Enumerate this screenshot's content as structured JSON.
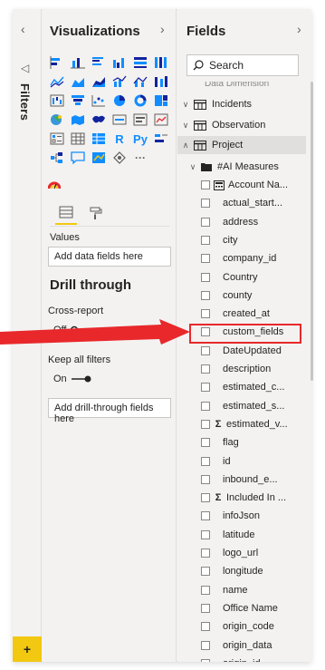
{
  "filters": {
    "label": "Filters",
    "collapse_icon": "chevron-left-icon",
    "add_button_label": "+"
  },
  "visualizations": {
    "title": "Visualizations",
    "expand_icon": "chevron-right-icon",
    "text_icons": [
      "R",
      "Py"
    ],
    "more_label": "···",
    "values_label": "Values",
    "values_well_placeholder": "Add data fields here",
    "drill_through_title": "Drill through",
    "cross_report_label": "Cross-report",
    "cross_report_state": "Off",
    "keep_all_filters_label": "Keep all filters",
    "keep_all_filters_state": "On",
    "drill_well_placeholder": "Add drill-through fields here"
  },
  "fields": {
    "title": "Fields",
    "expand_icon": "chevron-right-icon",
    "search_placeholder": "Search",
    "partial_top_item": "Data Dimension",
    "tables": [
      {
        "name": "Incidents",
        "expanded": false
      },
      {
        "name": "Observation",
        "expanded": false
      },
      {
        "name": "Project",
        "expanded": true
      }
    ],
    "measure_folder": "#AI Measures",
    "items": [
      {
        "label": "Account Na...",
        "kind": "calc"
      },
      {
        "label": "actual_start...",
        "kind": "field"
      },
      {
        "label": "address",
        "kind": "field"
      },
      {
        "label": "city",
        "kind": "field"
      },
      {
        "label": "company_id",
        "kind": "field"
      },
      {
        "label": "Country",
        "kind": "field"
      },
      {
        "label": "county",
        "kind": "field"
      },
      {
        "label": "created_at",
        "kind": "field"
      },
      {
        "label": "custom_fields",
        "kind": "field"
      },
      {
        "label": "DateUpdated",
        "kind": "field"
      },
      {
        "label": "description",
        "kind": "field"
      },
      {
        "label": "estimated_c...",
        "kind": "field"
      },
      {
        "label": "estimated_s...",
        "kind": "field"
      },
      {
        "label": "estimated_v...",
        "kind": "sum"
      },
      {
        "label": "flag",
        "kind": "field"
      },
      {
        "label": "id",
        "kind": "field"
      },
      {
        "label": "inbound_e...",
        "kind": "field"
      },
      {
        "label": "Included In ...",
        "kind": "sum"
      },
      {
        "label": "infoJson",
        "kind": "field"
      },
      {
        "label": "latitude",
        "kind": "field"
      },
      {
        "label": "logo_url",
        "kind": "field"
      },
      {
        "label": "longitude",
        "kind": "field"
      },
      {
        "label": "name",
        "kind": "field"
      },
      {
        "label": "Office Name",
        "kind": "field"
      },
      {
        "label": "origin_code",
        "kind": "field"
      },
      {
        "label": "origin_data",
        "kind": "field"
      },
      {
        "label": "origin_id",
        "kind": "field"
      }
    ]
  },
  "annotation": {
    "highlighted_item": "custom_fields",
    "color": "#e8282b"
  }
}
